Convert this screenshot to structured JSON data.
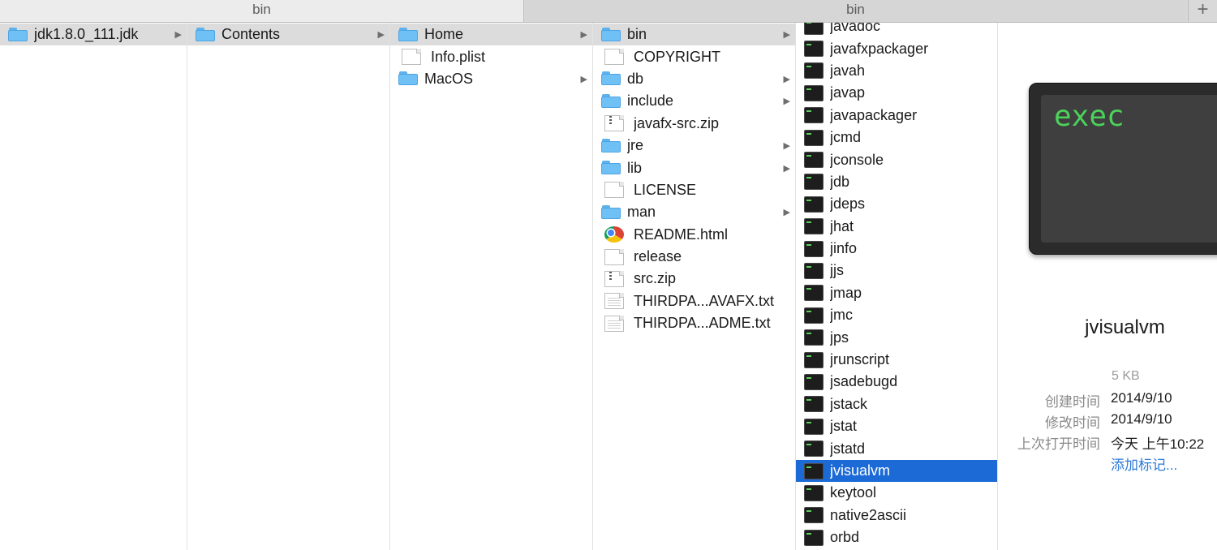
{
  "tabs": [
    {
      "label": "bin"
    },
    {
      "label": "bin"
    }
  ],
  "tab_add_label": "+",
  "columns": [
    {
      "items": [
        {
          "label": "jdk1.8.0_111.jdk",
          "icon": "folder-icon",
          "selected": "gray",
          "arrow": "▶"
        }
      ]
    },
    {
      "items": [
        {
          "label": "Contents",
          "icon": "folder-icon",
          "selected": "gray",
          "arrow": "▶"
        }
      ]
    },
    {
      "items": [
        {
          "label": "Home",
          "icon": "folder-icon",
          "selected": "gray",
          "arrow": "▶"
        },
        {
          "label": "Info.plist",
          "icon": "plist-file-icon"
        },
        {
          "label": "MacOS",
          "icon": "folder-icon",
          "arrow": "▶"
        }
      ]
    },
    {
      "items": [
        {
          "label": "bin",
          "icon": "folder-icon",
          "selected": "gray",
          "arrow": "▶"
        },
        {
          "label": "COPYRIGHT",
          "icon": "document-icon"
        },
        {
          "label": "db",
          "icon": "folder-icon",
          "arrow": "▶"
        },
        {
          "label": "include",
          "icon": "folder-icon",
          "arrow": "▶"
        },
        {
          "label": "javafx-src.zip",
          "icon": "zip-file-icon"
        },
        {
          "label": "jre",
          "icon": "folder-icon",
          "arrow": "▶"
        },
        {
          "label": "lib",
          "icon": "folder-icon",
          "arrow": "▶"
        },
        {
          "label": "LICENSE",
          "icon": "document-icon"
        },
        {
          "label": "man",
          "icon": "folder-icon",
          "arrow": "▶"
        },
        {
          "label": "README.html",
          "icon": "chrome-html-icon"
        },
        {
          "label": "release",
          "icon": "document-icon"
        },
        {
          "label": "src.zip",
          "icon": "zip-file-icon"
        },
        {
          "label": "THIRDPA...AVAFX.txt",
          "icon": "text-file-icon"
        },
        {
          "label": "THIRDPA...ADME.txt",
          "icon": "text-file-icon"
        }
      ]
    },
    {
      "items": [
        {
          "label": "javadoc",
          "icon": "exec-icon"
        },
        {
          "label": "javafxpackager",
          "icon": "exec-icon"
        },
        {
          "label": "javah",
          "icon": "exec-icon"
        },
        {
          "label": "javap",
          "icon": "exec-icon"
        },
        {
          "label": "javapackager",
          "icon": "exec-icon"
        },
        {
          "label": "jcmd",
          "icon": "exec-icon"
        },
        {
          "label": "jconsole",
          "icon": "exec-icon"
        },
        {
          "label": "jdb",
          "icon": "exec-icon"
        },
        {
          "label": "jdeps",
          "icon": "exec-icon"
        },
        {
          "label": "jhat",
          "icon": "exec-icon"
        },
        {
          "label": "jinfo",
          "icon": "exec-icon"
        },
        {
          "label": "jjs",
          "icon": "exec-icon"
        },
        {
          "label": "jmap",
          "icon": "exec-icon"
        },
        {
          "label": "jmc",
          "icon": "exec-icon"
        },
        {
          "label": "jps",
          "icon": "exec-icon"
        },
        {
          "label": "jrunscript",
          "icon": "exec-icon"
        },
        {
          "label": "jsadebugd",
          "icon": "exec-icon"
        },
        {
          "label": "jstack",
          "icon": "exec-icon"
        },
        {
          "label": "jstat",
          "icon": "exec-icon"
        },
        {
          "label": "jstatd",
          "icon": "exec-icon"
        },
        {
          "label": "jvisualvm",
          "icon": "exec-icon",
          "selected": "blue"
        },
        {
          "label": "keytool",
          "icon": "exec-icon"
        },
        {
          "label": "native2ascii",
          "icon": "exec-icon"
        },
        {
          "label": "orbd",
          "icon": "exec-icon"
        }
      ]
    }
  ],
  "preview": {
    "icon_text": "exec",
    "name": "jvisualvm",
    "size": "5 KB",
    "meta": [
      {
        "key": "创建时间",
        "value": "2014/9/10"
      },
      {
        "key": "修改时间",
        "value": "2014/9/10"
      },
      {
        "key": "上次打开时间",
        "value": "今天 上午10:22"
      }
    ],
    "add_tag": "添加标记..."
  },
  "colors": {
    "selection_blue": "#1c6ad6",
    "selection_gray": "#dcdcdc",
    "folder_blue": "#6fc0f5",
    "link_blue": "#2d7ad7",
    "exec_green": "#4bd25a"
  }
}
